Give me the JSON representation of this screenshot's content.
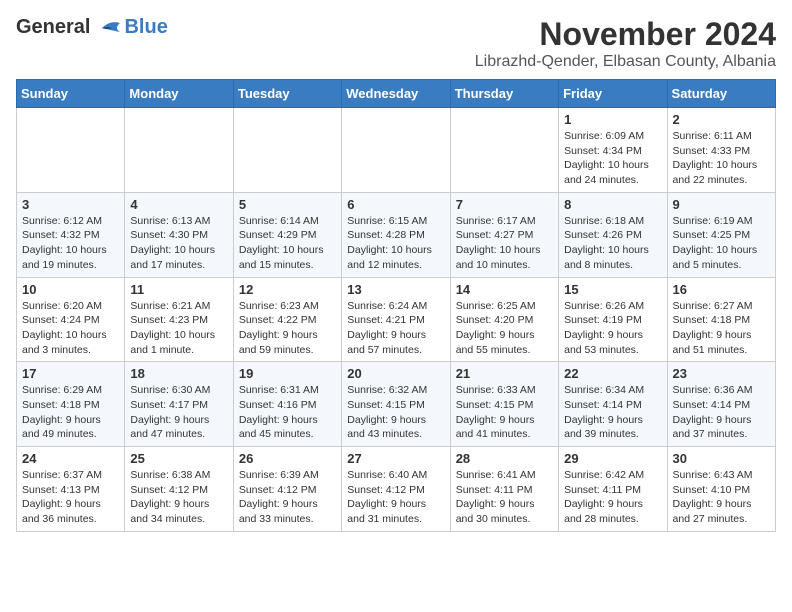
{
  "header": {
    "logo_general": "General",
    "logo_blue": "Blue",
    "month_title": "November 2024",
    "subtitle": "Librazhd-Qender, Elbasan County, Albania"
  },
  "weekdays": [
    "Sunday",
    "Monday",
    "Tuesday",
    "Wednesday",
    "Thursday",
    "Friday",
    "Saturday"
  ],
  "weeks": [
    [
      {
        "day": "",
        "info": ""
      },
      {
        "day": "",
        "info": ""
      },
      {
        "day": "",
        "info": ""
      },
      {
        "day": "",
        "info": ""
      },
      {
        "day": "",
        "info": ""
      },
      {
        "day": "1",
        "info": "Sunrise: 6:09 AM\nSunset: 4:34 PM\nDaylight: 10 hours and 24 minutes."
      },
      {
        "day": "2",
        "info": "Sunrise: 6:11 AM\nSunset: 4:33 PM\nDaylight: 10 hours and 22 minutes."
      }
    ],
    [
      {
        "day": "3",
        "info": "Sunrise: 6:12 AM\nSunset: 4:32 PM\nDaylight: 10 hours and 19 minutes."
      },
      {
        "day": "4",
        "info": "Sunrise: 6:13 AM\nSunset: 4:30 PM\nDaylight: 10 hours and 17 minutes."
      },
      {
        "day": "5",
        "info": "Sunrise: 6:14 AM\nSunset: 4:29 PM\nDaylight: 10 hours and 15 minutes."
      },
      {
        "day": "6",
        "info": "Sunrise: 6:15 AM\nSunset: 4:28 PM\nDaylight: 10 hours and 12 minutes."
      },
      {
        "day": "7",
        "info": "Sunrise: 6:17 AM\nSunset: 4:27 PM\nDaylight: 10 hours and 10 minutes."
      },
      {
        "day": "8",
        "info": "Sunrise: 6:18 AM\nSunset: 4:26 PM\nDaylight: 10 hours and 8 minutes."
      },
      {
        "day": "9",
        "info": "Sunrise: 6:19 AM\nSunset: 4:25 PM\nDaylight: 10 hours and 5 minutes."
      }
    ],
    [
      {
        "day": "10",
        "info": "Sunrise: 6:20 AM\nSunset: 4:24 PM\nDaylight: 10 hours and 3 minutes."
      },
      {
        "day": "11",
        "info": "Sunrise: 6:21 AM\nSunset: 4:23 PM\nDaylight: 10 hours and 1 minute."
      },
      {
        "day": "12",
        "info": "Sunrise: 6:23 AM\nSunset: 4:22 PM\nDaylight: 9 hours and 59 minutes."
      },
      {
        "day": "13",
        "info": "Sunrise: 6:24 AM\nSunset: 4:21 PM\nDaylight: 9 hours and 57 minutes."
      },
      {
        "day": "14",
        "info": "Sunrise: 6:25 AM\nSunset: 4:20 PM\nDaylight: 9 hours and 55 minutes."
      },
      {
        "day": "15",
        "info": "Sunrise: 6:26 AM\nSunset: 4:19 PM\nDaylight: 9 hours and 53 minutes."
      },
      {
        "day": "16",
        "info": "Sunrise: 6:27 AM\nSunset: 4:18 PM\nDaylight: 9 hours and 51 minutes."
      }
    ],
    [
      {
        "day": "17",
        "info": "Sunrise: 6:29 AM\nSunset: 4:18 PM\nDaylight: 9 hours and 49 minutes."
      },
      {
        "day": "18",
        "info": "Sunrise: 6:30 AM\nSunset: 4:17 PM\nDaylight: 9 hours and 47 minutes."
      },
      {
        "day": "19",
        "info": "Sunrise: 6:31 AM\nSunset: 4:16 PM\nDaylight: 9 hours and 45 minutes."
      },
      {
        "day": "20",
        "info": "Sunrise: 6:32 AM\nSunset: 4:15 PM\nDaylight: 9 hours and 43 minutes."
      },
      {
        "day": "21",
        "info": "Sunrise: 6:33 AM\nSunset: 4:15 PM\nDaylight: 9 hours and 41 minutes."
      },
      {
        "day": "22",
        "info": "Sunrise: 6:34 AM\nSunset: 4:14 PM\nDaylight: 9 hours and 39 minutes."
      },
      {
        "day": "23",
        "info": "Sunrise: 6:36 AM\nSunset: 4:14 PM\nDaylight: 9 hours and 37 minutes."
      }
    ],
    [
      {
        "day": "24",
        "info": "Sunrise: 6:37 AM\nSunset: 4:13 PM\nDaylight: 9 hours and 36 minutes."
      },
      {
        "day": "25",
        "info": "Sunrise: 6:38 AM\nSunset: 4:12 PM\nDaylight: 9 hours and 34 minutes."
      },
      {
        "day": "26",
        "info": "Sunrise: 6:39 AM\nSunset: 4:12 PM\nDaylight: 9 hours and 33 minutes."
      },
      {
        "day": "27",
        "info": "Sunrise: 6:40 AM\nSunset: 4:12 PM\nDaylight: 9 hours and 31 minutes."
      },
      {
        "day": "28",
        "info": "Sunrise: 6:41 AM\nSunset: 4:11 PM\nDaylight: 9 hours and 30 minutes."
      },
      {
        "day": "29",
        "info": "Sunrise: 6:42 AM\nSunset: 4:11 PM\nDaylight: 9 hours and 28 minutes."
      },
      {
        "day": "30",
        "info": "Sunrise: 6:43 AM\nSunset: 4:10 PM\nDaylight: 9 hours and 27 minutes."
      }
    ]
  ]
}
